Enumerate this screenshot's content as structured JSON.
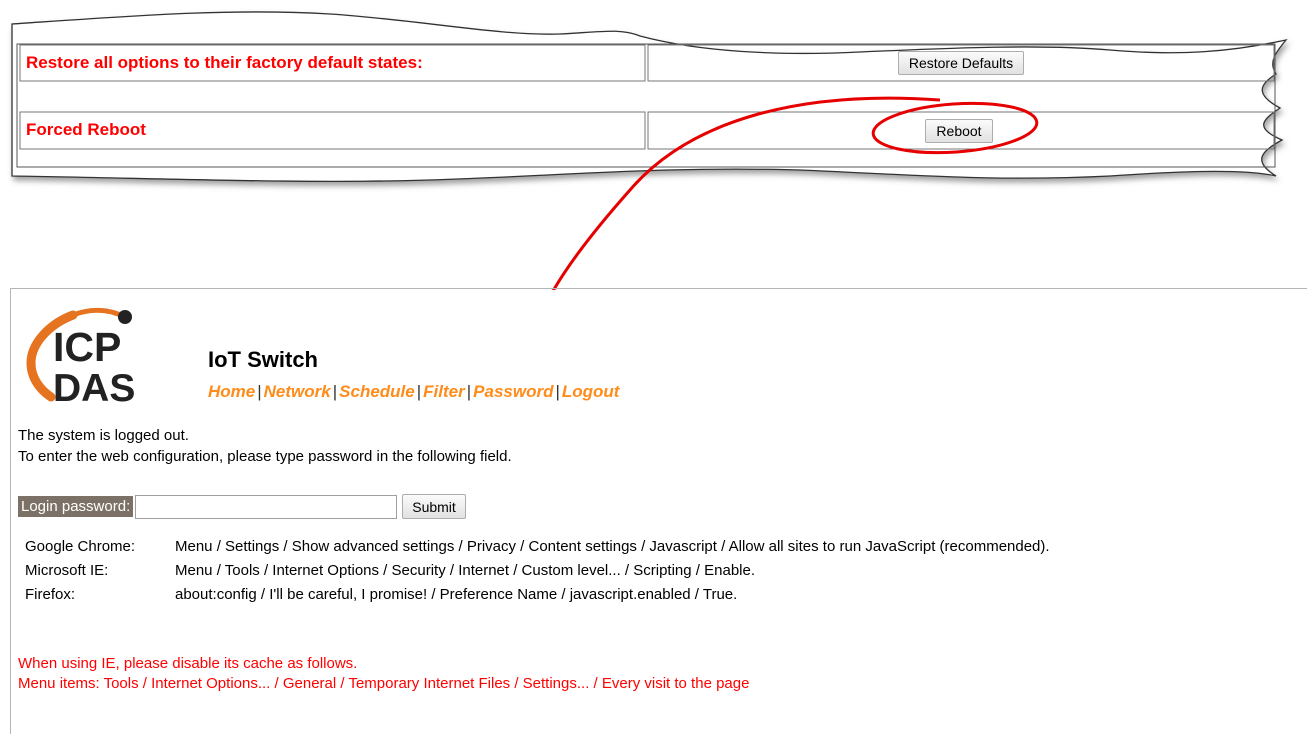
{
  "settings_snippet": {
    "restore_row": {
      "label": "Restore all options to their factory default states:",
      "button": "Restore Defaults"
    },
    "reboot_row": {
      "label": "Forced Reboot",
      "button": "Reboot"
    }
  },
  "login_page": {
    "logo": {
      "line1": "ICP",
      "line2": "DAS"
    },
    "app_title": "IoT Switch",
    "nav": {
      "items": [
        "Home",
        "Network",
        "Schedule",
        "Filter",
        "Password",
        "Logout"
      ],
      "separator": "|"
    },
    "status_text": "The system is logged out.",
    "instruction_text": "To enter the web configuration, please type password in the following field.",
    "login_label": "Login password:",
    "password_value": "",
    "submit_label": "Submit",
    "browser_hints": [
      {
        "browser": "Google Chrome:",
        "steps": "Menu / Settings / Show advanced settings / Privacy / Content settings / Javascript / Allow all sites to run JavaScript (recommended)."
      },
      {
        "browser": "Microsoft IE:",
        "steps": "Menu / Tools / Internet Options / Security / Internet / Custom level... / Scripting / Enable."
      },
      {
        "browser": "Firefox:",
        "steps": "about:config / I'll be careful, I promise! / Preference Name / javascript.enabled / True."
      }
    ],
    "ie_cache_note": "When using IE, please disable its cache as follows.",
    "ie_cache_steps": "Menu items: Tools / Internet Options... / General / Temporary Internet Files / Settings... / Every visit to the page"
  },
  "colors": {
    "warning_red": "#ff0000",
    "nav_orange": "#ff8c1a",
    "label_bg": "#7b7166",
    "annotation_red": "#e60000"
  }
}
